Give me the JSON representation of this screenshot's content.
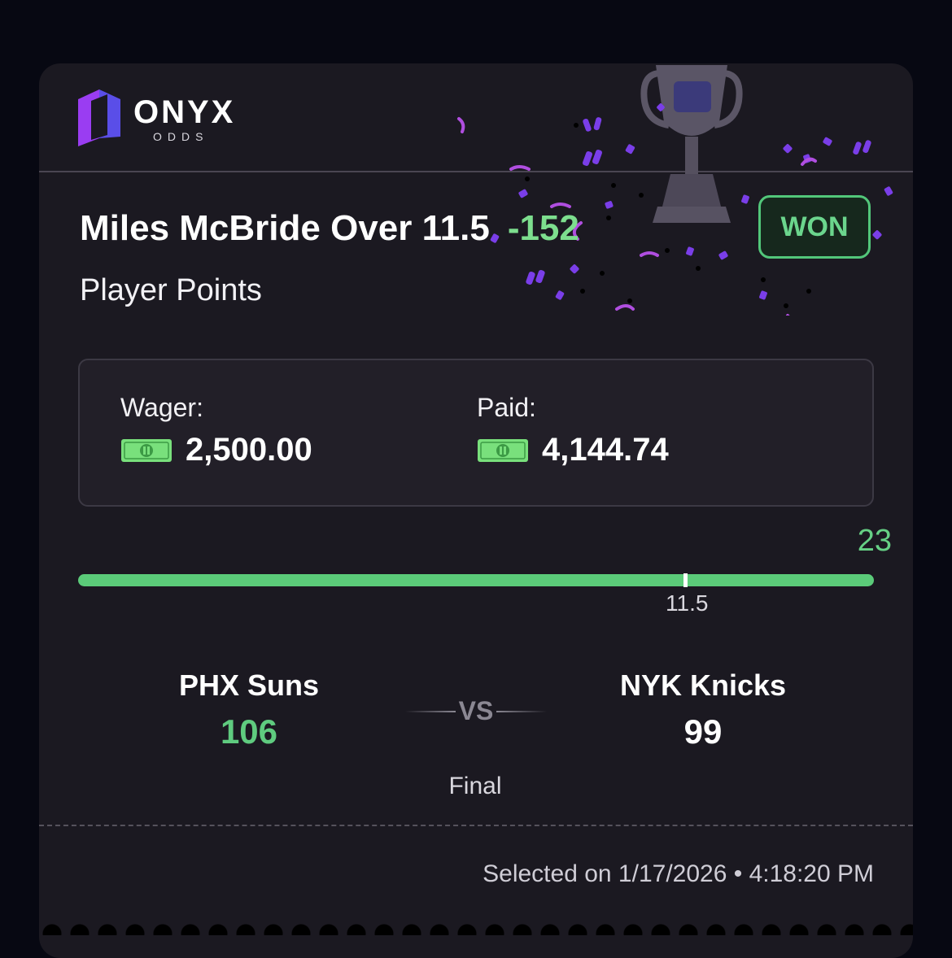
{
  "brand": {
    "name": "ONYX",
    "sub": "ODDS",
    "logo_icon": "onyx-logo-icon",
    "colors": {
      "purple": "#8b3df0",
      "blue": "#5a4ee8"
    }
  },
  "bet": {
    "title": "Miles McBride Over 11.5",
    "odds": "-152",
    "market": "Player Points",
    "status": "WON"
  },
  "wager": {
    "label": "Wager:",
    "amount": "2,500.00",
    "paid_label": "Paid:",
    "paid_amount": "4,144.74",
    "currency_icon": "cash-bill-icon"
  },
  "progress": {
    "actual": "23",
    "line": "11.5",
    "fill_fraction": 1.0
  },
  "game": {
    "home_team": "PHX Suns",
    "home_score": "106",
    "away_team": "NYK Knicks",
    "away_score": "99",
    "vs": "VS",
    "status": "Final"
  },
  "footer": {
    "selected": "Selected on 1/17/2026 • 4:18:20 PM"
  },
  "colors": {
    "card_bg": "#1b1921",
    "win_green": "#6bd58d",
    "bar_green": "#5bcb79"
  }
}
